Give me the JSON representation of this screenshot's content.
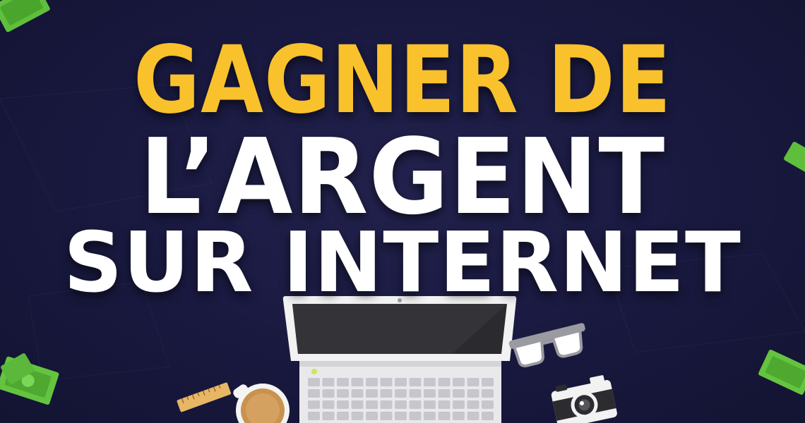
{
  "headline": {
    "line1": "GAGNER DE",
    "line2": "L’ARGENT",
    "line3": "SUR INTERNET"
  },
  "colors": {
    "background": "#1a1a42",
    "headline_accent": "#f9c12c",
    "headline_main": "#ffffff",
    "banknote": "#5fbf3c"
  },
  "illustration": {
    "objects": [
      "laptop",
      "coffee-cup",
      "ruler",
      "glasses",
      "camera",
      "banknotes"
    ]
  }
}
